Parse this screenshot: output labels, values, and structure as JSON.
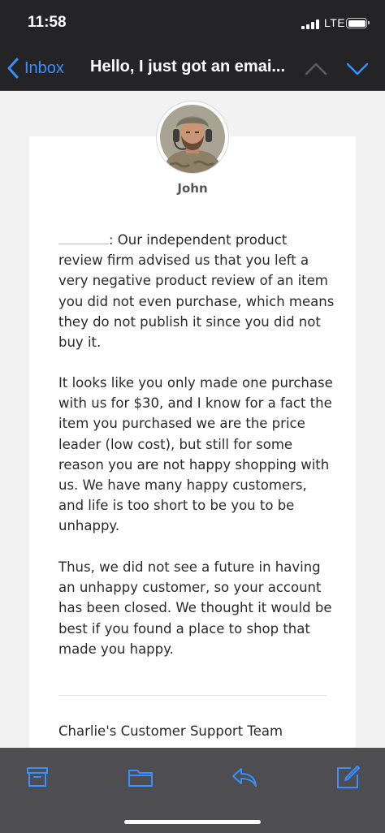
{
  "status_bar": {
    "time": "11:58",
    "network": "LTE"
  },
  "nav": {
    "back_label": "Inbox",
    "subject": "Hello, I just got an emai...",
    "icons": {
      "back": "chevron-left-icon",
      "previous": "chevron-up-icon",
      "next": "chevron-down-icon"
    }
  },
  "message": {
    "sender": "John",
    "paragraphs": [
      ":  Our independent product review firm advised us that you left a very negative product review of an item you did not even purchase, which means they do not publish it since you did not buy it.",
      "It looks like you only made one purchase with us for $30, and I know for a fact the item you purchased we are the price leader (low cost), but still for some reason you are not happy shopping with us.  We have many happy customers, and life is too short to be you to be unhappy.",
      "Thus, we did not see a future in having an unhappy customer, so your account has been closed.  We thought it would be best if you found a place to shop that made you happy."
    ],
    "signature": "Charlie's Customer Support Team"
  },
  "toolbar": {
    "icons": [
      "archive-icon",
      "folder-icon",
      "reply-icon",
      "compose-icon"
    ]
  },
  "colors": {
    "accent": "#3a8ffa",
    "header_background": "#242427",
    "toolbar_background": "#4d4d52",
    "page_background": "#f2f2f3"
  }
}
